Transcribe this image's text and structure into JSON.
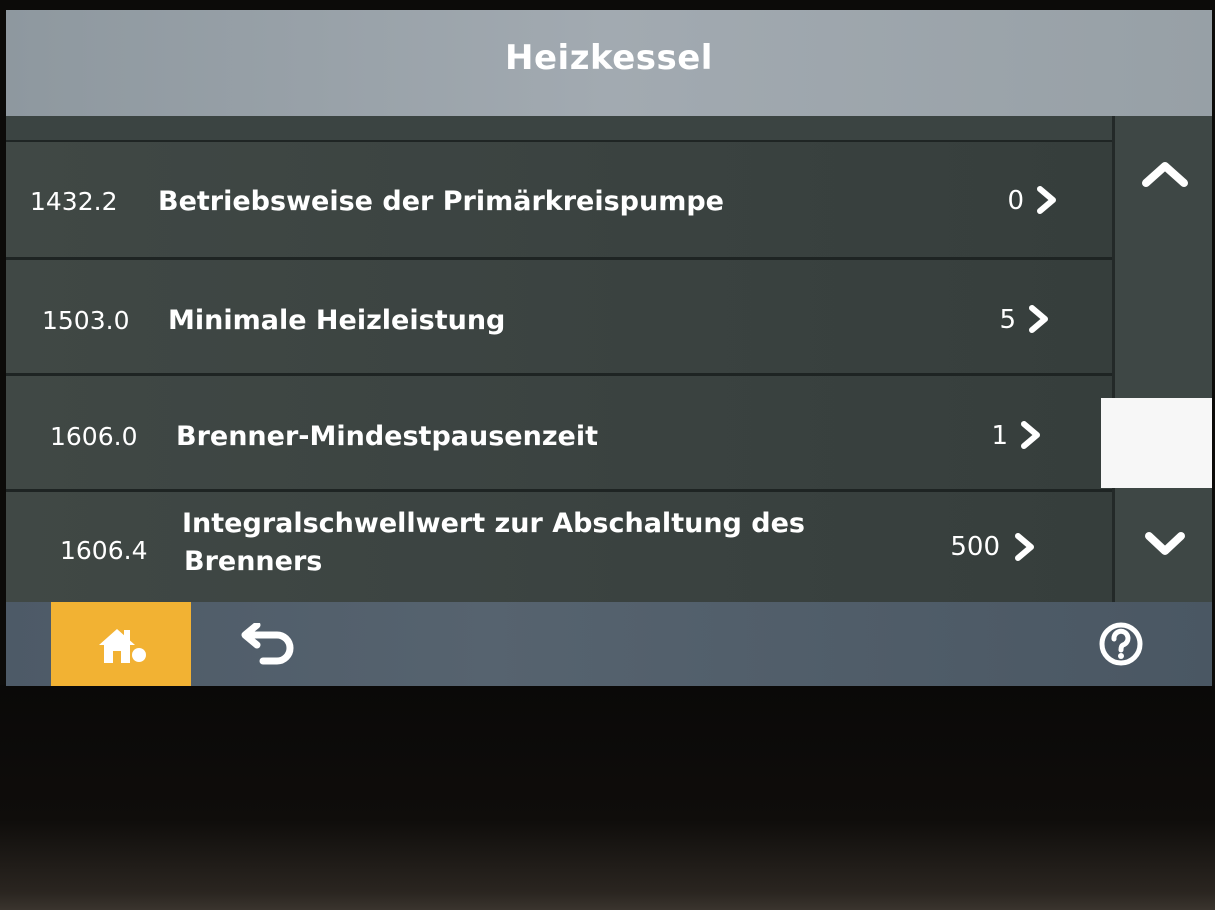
{
  "header": {
    "title": "Heizkessel"
  },
  "rows": [
    {
      "id": "1432.2",
      "label": "Betriebsweise der Primärkreispumpe",
      "value": "0"
    },
    {
      "id": "1503.0",
      "label": "Minimale Heizleistung",
      "value": "5"
    },
    {
      "id": "1606.0",
      "label": "Brenner-Mindestpausenzeit",
      "value": "1"
    },
    {
      "id": "1606.4",
      "label_line1": "Integralschwellwert zur Abschaltung des",
      "label_line2": "Brenners",
      "value": "500"
    }
  ],
  "icons": {
    "row_chevron": "chevron-right-icon",
    "scroll_up": "chevron-up-icon",
    "scroll_down": "chevron-down-icon",
    "home": "home-icon",
    "back": "back-arrow-icon",
    "help": "help-icon"
  },
  "colors": {
    "home_accent": "#f2b233",
    "header_bg": "#a2aab1",
    "row_bg": "#3a4240",
    "footer_bg": "#56636f",
    "scroll_thumb": "#f7f7f7"
  }
}
